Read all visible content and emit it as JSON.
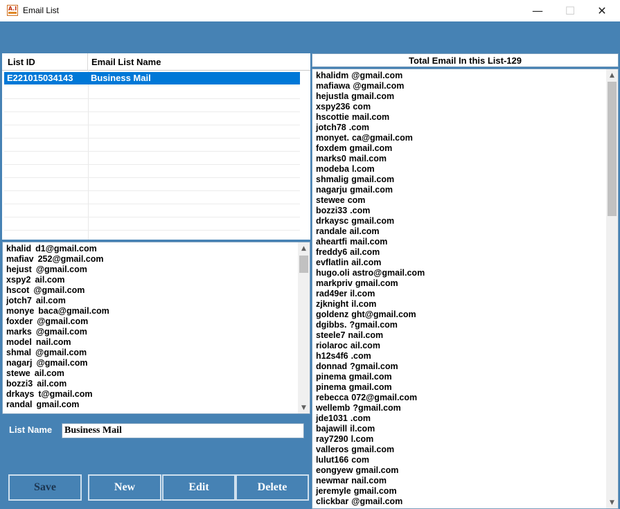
{
  "window": {
    "title": "Email List",
    "app_icon_text": "A.I",
    "min_glyph": "—",
    "max_glyph": "☐",
    "close_glyph": "✕"
  },
  "grid": {
    "columns": [
      "List ID",
      "Email List Name"
    ],
    "rows": [
      {
        "id": "E221015034143",
        "name": "Business Mail",
        "selected": true
      }
    ]
  },
  "left_list": {
    "items": [
      {
        "pre": "khalid",
        "post": "d1@gmail.com"
      },
      {
        "pre": "mafiav",
        "post": "252@gmail.com"
      },
      {
        "pre": "hejust",
        "post": "@gmail.com"
      },
      {
        "pre": "xspy2",
        "post": "ail.com"
      },
      {
        "pre": "hscot",
        "post": "@gmail.com"
      },
      {
        "pre": "jotch7",
        "post": "ail.com"
      },
      {
        "pre": "monye",
        "post": "baca@gmail.com"
      },
      {
        "pre": "foxder",
        "post": "@gmail.com"
      },
      {
        "pre": "marks",
        "post": "@gmail.com"
      },
      {
        "pre": "model",
        "post": "nail.com"
      },
      {
        "pre": "shmal",
        "post": "@gmail.com"
      },
      {
        "pre": "nagarj",
        "post": "@gmail.com"
      },
      {
        "pre": "stewe",
        "post": "ail.com"
      },
      {
        "pre": "bozzi3",
        "post": "ail.com"
      },
      {
        "pre": "drkays",
        "post": "t@gmail.com"
      },
      {
        "pre": "randal",
        "post": "gmail.com"
      }
    ],
    "scroll_up": "▲",
    "scroll_down": "▼"
  },
  "form": {
    "list_name_label": "List Name",
    "list_name_value": "Business Mail"
  },
  "buttons": {
    "save": "Save",
    "new": "New",
    "edit": "Edit",
    "delete": "Delete"
  },
  "right_panel": {
    "header": "Total Email In this List-129",
    "items": [
      {
        "pre": "khalidm",
        "post": "@gmail.com"
      },
      {
        "pre": "mafiawa",
        "post": "@gmail.com"
      },
      {
        "pre": "hejustla",
        "post": "gmail.com"
      },
      {
        "pre": "xspy236",
        "post": "com"
      },
      {
        "pre": "hscottie",
        "post": "mail.com"
      },
      {
        "pre": "jotch78",
        "post": ".com"
      },
      {
        "pre": "monyet.",
        "post": "ca@gmail.com"
      },
      {
        "pre": "foxdem",
        "post": "gmail.com"
      },
      {
        "pre": "marks0",
        "post": "mail.com"
      },
      {
        "pre": "modeba",
        "post": "l.com"
      },
      {
        "pre": "shmalig",
        "post": "gmail.com"
      },
      {
        "pre": "nagarju",
        "post": "gmail.com"
      },
      {
        "pre": "stewee",
        "post": "com"
      },
      {
        "pre": "bozzi33",
        "post": ".com"
      },
      {
        "pre": "drkaysc",
        "post": "gmail.com"
      },
      {
        "pre": "randale",
        "post": "ail.com"
      },
      {
        "pre": "aheartfi",
        "post": "mail.com"
      },
      {
        "pre": "freddy6",
        "post": "ail.com"
      },
      {
        "pre": "evflatlin",
        "post": "ail.com"
      },
      {
        "pre": "hugo.oli",
        "post": "astro@gmail.com"
      },
      {
        "pre": "markpriv",
        "post": "gmail.com"
      },
      {
        "pre": "rad49er",
        "post": "il.com"
      },
      {
        "pre": "zjknight",
        "post": "il.com"
      },
      {
        "pre": "goldenz",
        "post": "ght@gmail.com"
      },
      {
        "pre": "dgibbs.",
        "post": "?gmail.com"
      },
      {
        "pre": "steele7",
        "post": "nail.com"
      },
      {
        "pre": "riolaroc",
        "post": "ail.com"
      },
      {
        "pre": "h12s4f6",
        "post": ".com"
      },
      {
        "pre": "donnad",
        "post": "?gmail.com"
      },
      {
        "pre": "pinema",
        "post": "gmail.com"
      },
      {
        "pre": "pinema",
        "post": "gmail.com"
      },
      {
        "pre": "rebecca",
        "post": "072@gmail.com"
      },
      {
        "pre": "wellemb",
        "post": "?gmail.com"
      },
      {
        "pre": "jde1031",
        "post": ".com"
      },
      {
        "pre": "bajawill",
        "post": "il.com"
      },
      {
        "pre": "ray7290",
        "post": "l.com"
      },
      {
        "pre": "valleros",
        "post": "gmail.com"
      },
      {
        "pre": "lulut166",
        "post": "com"
      },
      {
        "pre": "eongyew",
        "post": "gmail.com"
      },
      {
        "pre": "newmar",
        "post": "nail.com"
      },
      {
        "pre": "jeremyle",
        "post": "gmail.com"
      },
      {
        "pre": "clickbar",
        "post": "@gmail.com"
      }
    ],
    "scroll_up": "▲",
    "scroll_down": "▼"
  }
}
